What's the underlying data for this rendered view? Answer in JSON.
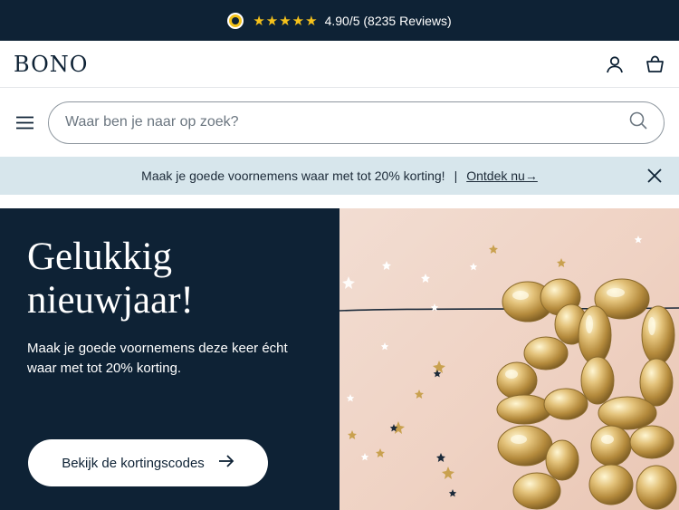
{
  "rating_bar": {
    "stars": "★★★★★",
    "rating_text": "4.90/5 (8235 Reviews)"
  },
  "header": {
    "logo": "BONO",
    "icons": [
      "account-icon",
      "cart-icon"
    ]
  },
  "search": {
    "placeholder": "Waar ben je naar op zoek?",
    "value": ""
  },
  "promo_bar": {
    "message": "Maak je goede voornemens waar met tot 20% korting!",
    "separator": "|",
    "link_label": "Ontdek nu→",
    "background": "#d7e6ec"
  },
  "hero": {
    "title_line1": "Gelukkig",
    "title_line2": "nieuwjaar!",
    "text": "Maak je goede voornemens deze keer écht waar met tot 20% korting.",
    "cta_label": "Bekijk de kortingscodes",
    "cta_arrow": "→",
    "image_alt": "gold-balloons-2025-image"
  },
  "colors": {
    "navy": "#0e2235",
    "gold": "#f6c21b",
    "promo": "#d7e6ec"
  }
}
